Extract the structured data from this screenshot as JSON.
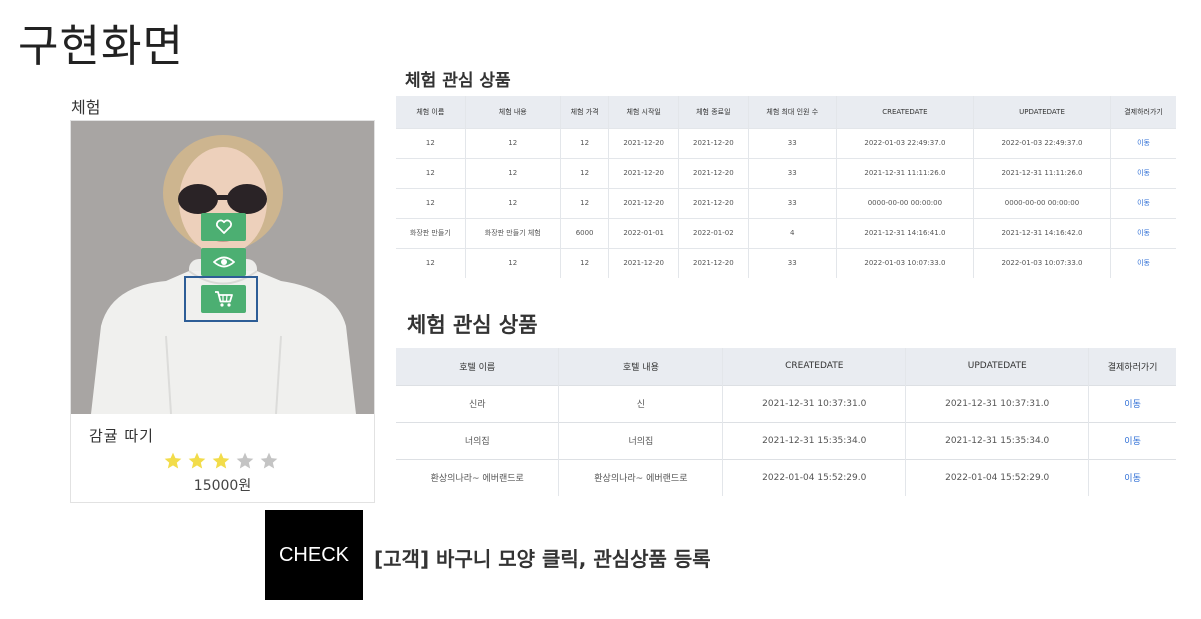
{
  "page": {
    "title": "구현화면"
  },
  "product_section": {
    "label": "체험"
  },
  "product_card": {
    "name": "감귤 따기",
    "price": "15000원",
    "rating": 3,
    "rating_max": 5,
    "star_colors": {
      "filled": "#f2dc4a",
      "empty": "#c4c4c4"
    },
    "buttons": {
      "wishlist_icon": "heart-icon",
      "quickview_icon": "eye-icon",
      "cart_icon": "cart-icon",
      "button_color": "#4caf72"
    },
    "highlight_color": "#2d5d96"
  },
  "experience_table": {
    "title": "체험 관심 상품",
    "headers": [
      "체험 이름",
      "체험 내용",
      "체험 가격",
      "체험 시작일",
      "체험 종료일",
      "체험 최대 인원 수",
      "CREATEDATE",
      "UPDATEDATE",
      "결제하러가기"
    ],
    "rows": [
      [
        "12",
        "12",
        "12",
        "2021-12-20",
        "2021-12-20",
        "33",
        "2022-01-03 22:49:37.0",
        "2022-01-03 22:49:37.0",
        "이동"
      ],
      [
        "12",
        "12",
        "12",
        "2021-12-20",
        "2021-12-20",
        "33",
        "2021-12-31 11:11:26.0",
        "2021-12-31 11:11:26.0",
        "이동"
      ],
      [
        "12",
        "12",
        "12",
        "2021-12-20",
        "2021-12-20",
        "33",
        "0000-00-00 00:00:00",
        "0000-00-00 00:00:00",
        "이동"
      ],
      [
        "화장판 만들기",
        "화장판 만들기 체험",
        "6000",
        "2022-01-01",
        "2022-01-02",
        "4",
        "2021-12-31 14:16:41.0",
        "2021-12-31 14:16:42.0",
        "이동"
      ],
      [
        "12",
        "12",
        "12",
        "2021-12-20",
        "2021-12-20",
        "33",
        "2022-01-03 10:07:33.0",
        "2022-01-03 10:07:33.0",
        "이동"
      ]
    ]
  },
  "hotel_table": {
    "title": "체험 관심 상품",
    "headers": [
      "호텔 이름",
      "호텔 내용",
      "CREATEDATE",
      "UPDATEDATE",
      "결제하러가기"
    ],
    "rows": [
      [
        "신라",
        "신",
        "2021-12-31 10:37:31.0",
        "2021-12-31 10:37:31.0",
        "이동"
      ],
      [
        "너의집",
        "너의집",
        "2021-12-31 15:35:34.0",
        "2021-12-31 15:35:34.0",
        "이동"
      ],
      [
        "환상의나라~ 에버랜드로",
        "환상의나라~ 에버랜드로",
        "2022-01-04 15:52:29.0",
        "2022-01-04 15:52:29.0",
        "이동"
      ]
    ]
  },
  "check_note": {
    "badge": "CHECK",
    "caption": "[고객] 바구니 모양 클릭, 관심상품 등록"
  }
}
